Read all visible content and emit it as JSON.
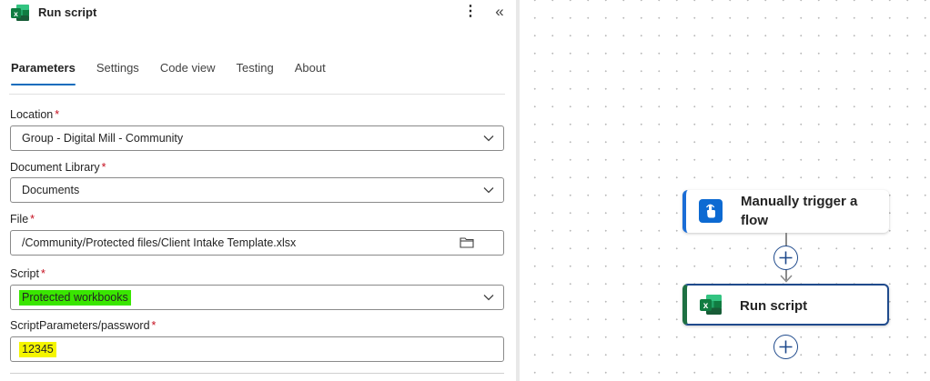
{
  "header": {
    "title": "Run script",
    "more_glyph": "⋮",
    "collapse_glyph": "«"
  },
  "tabs": [
    {
      "label": "Parameters",
      "active": true
    },
    {
      "label": "Settings"
    },
    {
      "label": "Code view"
    },
    {
      "label": "Testing"
    },
    {
      "label": "About"
    }
  ],
  "fields": {
    "location": {
      "label": "Location",
      "required": "*",
      "value": "Group - Digital Mill - Community"
    },
    "document_library": {
      "label": "Document Library",
      "required": "*",
      "value": "Documents"
    },
    "file": {
      "label": "File",
      "required": "*",
      "value": "/Community/Protected files/Client Intake Template.xlsx"
    },
    "script": {
      "label": "Script",
      "required": "*",
      "value": "Protected workbooks",
      "highlight": "#39e600"
    },
    "password": {
      "label": "ScriptParameters/password",
      "required": "*",
      "value": "12345",
      "highlight": "#f4f500"
    }
  },
  "canvas": {
    "trigger_node": {
      "title": "Manually trigger a flow",
      "icon": "touch-hand-icon",
      "accent": "#1a6dd6"
    },
    "run_node": {
      "title": "Run script",
      "icon": "excel-icon",
      "accent": "#1d6f42"
    }
  },
  "colors": {
    "tab_underline": "#0f6cbd",
    "required": "#c50f1f",
    "excel_green": "#107c41"
  }
}
